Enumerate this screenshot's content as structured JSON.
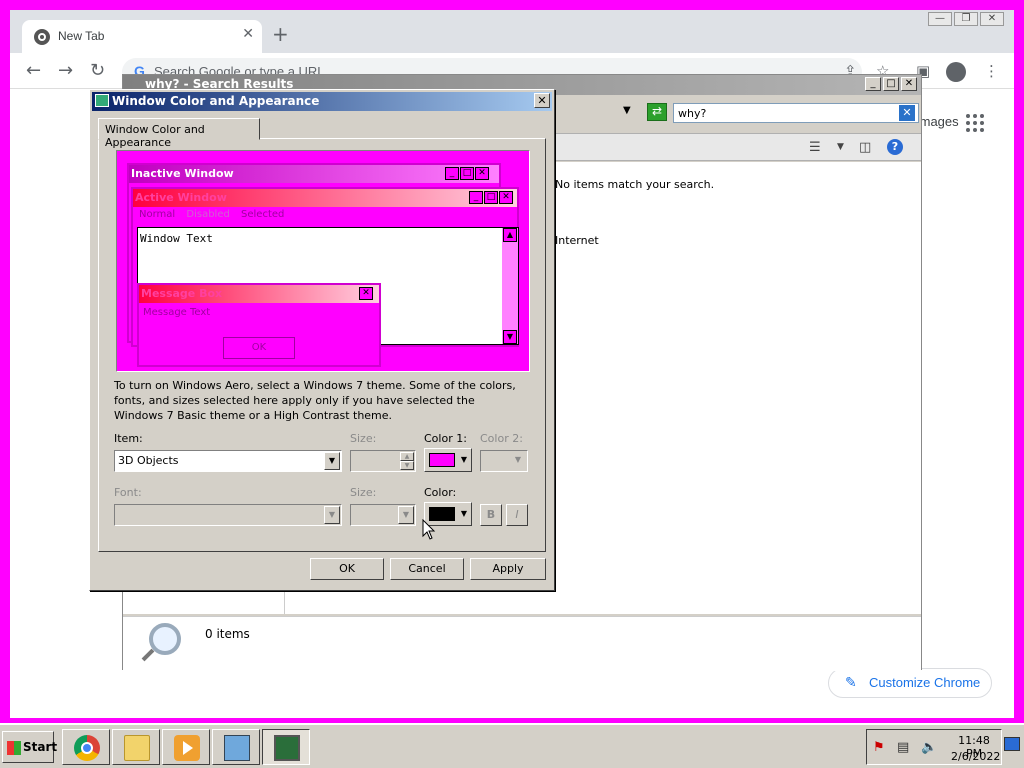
{
  "chrome": {
    "tab_title": "New Tab",
    "omnibox_placeholder": "Search Google or type a URL",
    "images_link": "Images",
    "customize_label": "Customize Chrome"
  },
  "explorer": {
    "title": "why? - Search Results",
    "search_value": "why?",
    "no_match_text": "No items match your search.",
    "internet_text": "Internet",
    "item_count": "0 items"
  },
  "dialog": {
    "title": "Window Color and Appearance",
    "tab_label": "Window Color and Appearance",
    "preview": {
      "inactive_title": "Inactive Window",
      "active_title": "Active Window",
      "menu_normal": "Normal",
      "menu_disabled": "Disabled",
      "menu_selected": "Selected",
      "window_text": "Window Text",
      "message_box_title": "Message Box",
      "message_text": "Message Text",
      "ok_label": "OK"
    },
    "description": "To turn on Windows Aero, select a Windows 7 theme.  Some of the colors, fonts, and sizes selected here apply only if you have selected the Windows 7 Basic theme or a High Contrast theme.",
    "item_label": "Item:",
    "item_value": "3D Objects",
    "size_label": "Size:",
    "color1_label": "Color 1:",
    "color2_label": "Color 2:",
    "font_label": "Font:",
    "font_size_label": "Size:",
    "font_color_label": "Color:",
    "bold_label": "B",
    "italic_label": "I",
    "ok_button": "OK",
    "cancel_button": "Cancel",
    "apply_button": "Apply",
    "colors": {
      "color1": "#ff00ff",
      "font_color": "#000000"
    }
  },
  "taskbar": {
    "start_label": "Start",
    "time": "11:48 PM",
    "date": "2/6/2022",
    "items": [
      "chrome-icon",
      "folder-icon",
      "media-player-icon",
      "control-panel-icon",
      "display-settings-icon"
    ]
  },
  "desktop": {
    "background_color": "#ff00ff"
  }
}
